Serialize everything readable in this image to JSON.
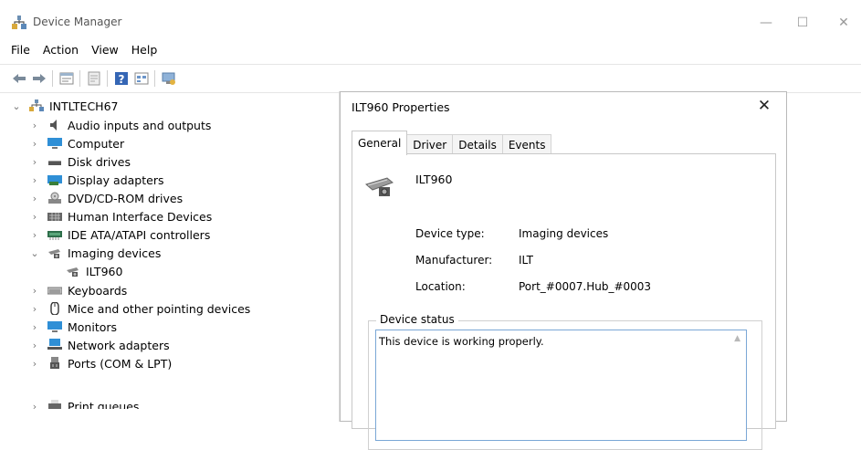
{
  "window": {
    "title": "Device Manager",
    "minimize_glyph": "—",
    "maximize_glyph": "☐",
    "close_glyph": "✕"
  },
  "menu": [
    "File",
    "Action",
    "View",
    "Help"
  ],
  "toolbar": {
    "buttons": [
      "back-icon",
      "forward-icon",
      "properties-icon",
      "update-driver-icon",
      "help-icon",
      "view-icon",
      "scan-hardware-icon"
    ]
  },
  "tree": {
    "root": "INTLTECH67",
    "items": [
      {
        "label": "Audio inputs and outputs",
        "icon": "speaker-icon",
        "expanded": false
      },
      {
        "label": "Computer",
        "icon": "monitor-icon",
        "expanded": false
      },
      {
        "label": "Disk drives",
        "icon": "disk-drive-icon",
        "expanded": false
      },
      {
        "label": "Display adapters",
        "icon": "display-adapter-icon",
        "expanded": false
      },
      {
        "label": "DVD/CD-ROM drives",
        "icon": "dvd-drive-icon",
        "expanded": false
      },
      {
        "label": "Human Interface Devices",
        "icon": "hid-icon",
        "expanded": false
      },
      {
        "label": "IDE ATA/ATAPI controllers",
        "icon": "ide-controller-icon",
        "expanded": false
      },
      {
        "label": "Imaging devices",
        "icon": "imaging-device-icon",
        "expanded": true
      },
      {
        "label": "ILT960",
        "icon": "imaging-device-icon",
        "child": true
      },
      {
        "label": "Keyboards",
        "icon": "keyboard-icon",
        "expanded": false
      },
      {
        "label": "Mice and other pointing devices",
        "icon": "mouse-icon",
        "expanded": false
      },
      {
        "label": "Monitors",
        "icon": "monitor-icon",
        "expanded": false
      },
      {
        "label": "Network adapters",
        "icon": "network-adapter-icon",
        "expanded": false
      },
      {
        "label": "Ports (COM & LPT)",
        "icon": "port-icon",
        "expanded": false
      },
      {
        "label": "Print queues",
        "icon": "printer-icon",
        "expanded": false
      }
    ]
  },
  "dialog": {
    "title": "ILT960 Properties",
    "close_glyph": "✕",
    "tabs": [
      "General",
      "Driver",
      "Details",
      "Events"
    ],
    "active_tab": "General",
    "device_name": "ILT960",
    "properties": [
      {
        "label": "Device type:",
        "value": "Imaging devices"
      },
      {
        "label": "Manufacturer:",
        "value": "ILT"
      },
      {
        "label": "Location:",
        "value": "Port_#0007.Hub_#0003"
      }
    ],
    "status_group_label": "Device status",
    "status_text": "This device is working properly."
  }
}
